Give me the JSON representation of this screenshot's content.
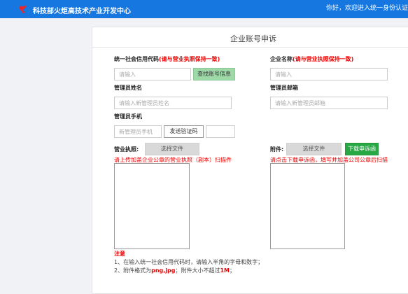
{
  "header": {
    "org_name": "科技部火炬高技术产业开发中心",
    "greeting": "你好，欢迎进入统一身份认证",
    "accent": "#1677e0"
  },
  "page": {
    "title": "企业账号申诉"
  },
  "form": {
    "credit_code": {
      "label": "统一社会信用代码",
      "note": "(请与营业执照保持一致)",
      "placeholder": "请输入",
      "button": "查找账号信息"
    },
    "company_name": {
      "label": "企业名称",
      "note": "(请与营业执照保持一致)",
      "placeholder": "请输入"
    },
    "admin_name": {
      "label": "管理员姓名",
      "placeholder": "请输入新管理员姓名"
    },
    "admin_email": {
      "label": "管理员邮箱",
      "placeholder": "请输入新管理员邮箱"
    },
    "admin_phone": {
      "label": "管理员手机",
      "placeholder": "新管理员手机",
      "send_code": "发送验证码"
    },
    "license": {
      "label": "营业执照:",
      "choose": "选择文件",
      "hint": "请上传加盖企业公章的营业执照（副本）扫描件"
    },
    "attachment": {
      "label": "附件:",
      "choose": "选择文件",
      "download": "下载申诉函",
      "hint": "请点击下载申诉函，填写并加盖公司公章后扫描"
    }
  },
  "notes": {
    "title": "注意",
    "line1": "1、在输入统一社会信用代码时，请输入半角的字母和数字；",
    "line2_prefix": "2、附件格式为",
    "line2_format": "png,jpg",
    "line2_mid": "；附件大小不超过",
    "line2_size": "1M",
    "line2_suffix": "；"
  }
}
